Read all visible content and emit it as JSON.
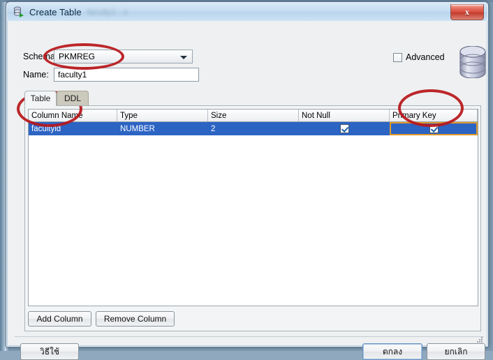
{
  "window": {
    "title": "Create Table",
    "ghost_title": "blurred-text",
    "icon": "database-table-icon",
    "close_label": "x"
  },
  "form": {
    "schema_label": "Schema:",
    "schema_value": "PKMREG",
    "name_label": "Name:",
    "name_value": "faculty1",
    "name_placeholder": "",
    "advanced_label": "Advanced",
    "advanced_checked": false,
    "decoration_icon": "database-cylinder-icon"
  },
  "tabs": [
    {
      "label": "Table",
      "active": true
    },
    {
      "label": "DDL",
      "active": false
    }
  ],
  "grid": {
    "columns": [
      "Column Name",
      "Type",
      "Size",
      "Not Null",
      "Primary Key"
    ],
    "rows": [
      {
        "column_name": "facultyid",
        "type": "NUMBER",
        "size": "2",
        "not_null": true,
        "primary_key": true,
        "selected": true
      }
    ]
  },
  "grid_buttons": {
    "add_column": "Add Column",
    "remove_column": "Remove Column"
  },
  "footer": {
    "help": "วิธีใช้",
    "ok": "ตกลง",
    "cancel": "ยกเลิก"
  },
  "colors": {
    "selection_blue": "#2c64c4",
    "focus_orange": "#e09a2c",
    "annotation_red": "#b8171b",
    "titlebar_blue": "#c5dcf0",
    "close_red": "#d4483a"
  }
}
